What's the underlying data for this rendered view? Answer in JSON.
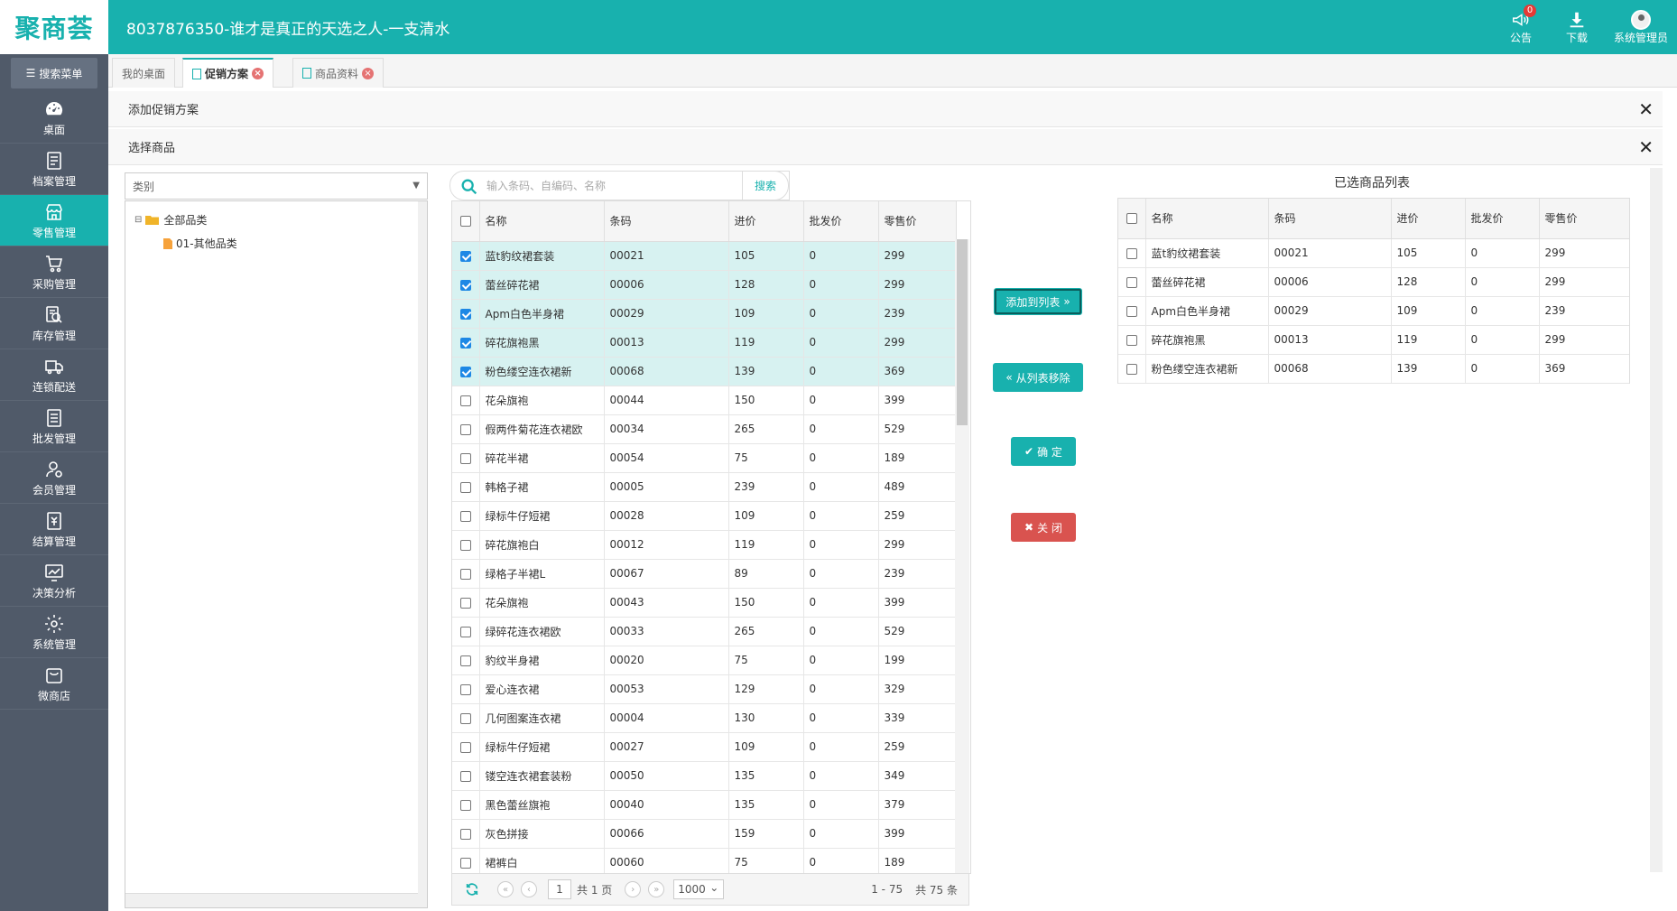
{
  "header": {
    "logo": "聚商荟",
    "title": "8037876350-谁才是真正的天选之人-一支清水",
    "notice_label": "公告",
    "notice_count": "0",
    "download_label": "下载",
    "user_label": "系统管理员"
  },
  "sidebar": {
    "search_label": "搜索菜单",
    "items": [
      {
        "label": "桌面",
        "icon": "dashboard-icon"
      },
      {
        "label": "档案管理",
        "icon": "file-icon"
      },
      {
        "label": "零售管理",
        "icon": "store-icon",
        "active": true
      },
      {
        "label": "采购管理",
        "icon": "cart-icon"
      },
      {
        "label": "库存管理",
        "icon": "inventory-icon"
      },
      {
        "label": "连锁配送",
        "icon": "truck-icon"
      },
      {
        "label": "批发管理",
        "icon": "wholesale-icon"
      },
      {
        "label": "会员管理",
        "icon": "member-icon"
      },
      {
        "label": "结算管理",
        "icon": "settlement-icon"
      },
      {
        "label": "决策分析",
        "icon": "chart-icon"
      },
      {
        "label": "系统管理",
        "icon": "gear-icon"
      },
      {
        "label": "微商店",
        "icon": "bag-icon"
      }
    ]
  },
  "tabs": [
    {
      "label": "我的桌面"
    },
    {
      "label": "促销方案",
      "active": true
    },
    {
      "label": "商品资料"
    }
  ],
  "panels": {
    "add_promo": "添加促销方案",
    "select_goods": "选择商品"
  },
  "category": {
    "placeholder": "类别",
    "root": "全部品类",
    "child": "01-其他品类"
  },
  "search": {
    "placeholder": "输入条码、自编码、名称",
    "button": "搜索"
  },
  "columns": [
    "名称",
    "条码",
    "进价",
    "批发价",
    "零售价"
  ],
  "goods": [
    {
      "name": "蓝t豹纹裙套装",
      "code": "00021",
      "cost": "105",
      "wholesale": "0",
      "retail": "299",
      "checked": true
    },
    {
      "name": "蕾丝碎花裙",
      "code": "00006",
      "cost": "128",
      "wholesale": "0",
      "retail": "299",
      "checked": true
    },
    {
      "name": "Apm白色半身裙",
      "code": "00029",
      "cost": "109",
      "wholesale": "0",
      "retail": "239",
      "checked": true
    },
    {
      "name": "碎花旗袍黑",
      "code": "00013",
      "cost": "119",
      "wholesale": "0",
      "retail": "299",
      "checked": true
    },
    {
      "name": "粉色缕空连衣裙新",
      "code": "00068",
      "cost": "139",
      "wholesale": "0",
      "retail": "369",
      "checked": true
    },
    {
      "name": "花朵旗袍",
      "code": "00044",
      "cost": "150",
      "wholesale": "0",
      "retail": "399",
      "checked": false
    },
    {
      "name": "假两件菊花连衣裙欧",
      "code": "00034",
      "cost": "265",
      "wholesale": "0",
      "retail": "529",
      "checked": false
    },
    {
      "name": "碎花半裙",
      "code": "00054",
      "cost": "75",
      "wholesale": "0",
      "retail": "189",
      "checked": false
    },
    {
      "name": "韩格子裙",
      "code": "00005",
      "cost": "239",
      "wholesale": "0",
      "retail": "489",
      "checked": false
    },
    {
      "name": "绿标牛仔短裙",
      "code": "00028",
      "cost": "109",
      "wholesale": "0",
      "retail": "259",
      "checked": false
    },
    {
      "name": "碎花旗袍白",
      "code": "00012",
      "cost": "119",
      "wholesale": "0",
      "retail": "299",
      "checked": false
    },
    {
      "name": "绿格子半裙L",
      "code": "00067",
      "cost": "89",
      "wholesale": "0",
      "retail": "239",
      "checked": false
    },
    {
      "name": "花朵旗袍",
      "code": "00043",
      "cost": "150",
      "wholesale": "0",
      "retail": "399",
      "checked": false
    },
    {
      "name": "绿碎花连衣裙欧",
      "code": "00033",
      "cost": "265",
      "wholesale": "0",
      "retail": "529",
      "checked": false
    },
    {
      "name": "豹纹半身裙",
      "code": "00020",
      "cost": "75",
      "wholesale": "0",
      "retail": "199",
      "checked": false
    },
    {
      "name": "爱心连衣裙",
      "code": "00053",
      "cost": "129",
      "wholesale": "0",
      "retail": "329",
      "checked": false
    },
    {
      "name": "几何图案连衣裙",
      "code": "00004",
      "cost": "130",
      "wholesale": "0",
      "retail": "339",
      "checked": false
    },
    {
      "name": "绿标牛仔短裙",
      "code": "00027",
      "cost": "109",
      "wholesale": "0",
      "retail": "259",
      "checked": false
    },
    {
      "name": "镂空连衣裙套装粉",
      "code": "00050",
      "cost": "135",
      "wholesale": "0",
      "retail": "349",
      "checked": false
    },
    {
      "name": "黑色蕾丝旗袍",
      "code": "00040",
      "cost": "135",
      "wholesale": "0",
      "retail": "379",
      "checked": false
    },
    {
      "name": "灰色拼接",
      "code": "00066",
      "cost": "159",
      "wholesale": "0",
      "retail": "399",
      "checked": false
    },
    {
      "name": "裙裤白",
      "code": "00060",
      "cost": "75",
      "wholesale": "0",
      "retail": "189",
      "checked": false
    }
  ],
  "pager": {
    "page": "1",
    "total_pages": "共 1 页",
    "page_size": "1000",
    "range": "1 - 75",
    "total": "共 75 条"
  },
  "actions": {
    "add": "添加到列表",
    "remove": "从列表移除",
    "confirm": "确 定",
    "close": "关 闭"
  },
  "selected": {
    "title": "已选商品列表",
    "rows": [
      {
        "name": "蓝t豹纹裙套装",
        "code": "00021",
        "cost": "105",
        "wholesale": "0",
        "retail": "299"
      },
      {
        "name": "蕾丝碎花裙",
        "code": "00006",
        "cost": "128",
        "wholesale": "0",
        "retail": "299"
      },
      {
        "name": "Apm白色半身裙",
        "code": "00029",
        "cost": "109",
        "wholesale": "0",
        "retail": "239"
      },
      {
        "name": "碎花旗袍黑",
        "code": "00013",
        "cost": "119",
        "wholesale": "0",
        "retail": "299"
      },
      {
        "name": "粉色缕空连衣裙新",
        "code": "00068",
        "cost": "139",
        "wholesale": "0",
        "retail": "369"
      }
    ]
  },
  "colors": {
    "accent": "#18b1ae",
    "sidebar": "#505a69",
    "danger": "#d9534f",
    "selected_row": "#d7f2f1"
  }
}
